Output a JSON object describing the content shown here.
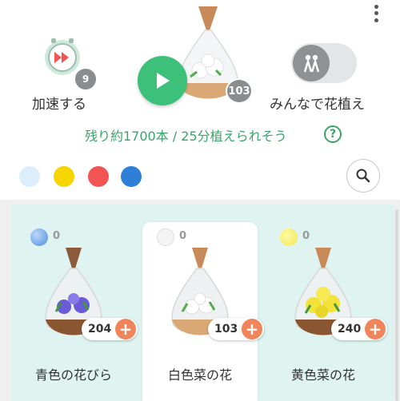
{
  "header": {
    "speed": {
      "label": "加速する",
      "count": "9",
      "icon": "fast-forward-clock-icon"
    },
    "current": {
      "count": "103",
      "icon": "play-icon"
    },
    "together": {
      "label": "みんなで花植え",
      "icon": "people-icon",
      "enabled": false
    },
    "remaining_text": "残り約1700本 / 25分植えられそう",
    "help_symbol": "?"
  },
  "filters": {
    "colors": [
      "#dceefc",
      "#f7d500",
      "#f25454",
      "#2e7fd8"
    ],
    "search_icon": "search-icon"
  },
  "items": [
    {
      "name": "青色の花びら",
      "owned": "0",
      "count": "204",
      "plus": "+",
      "accent": "#5aa0e8"
    },
    {
      "name": "白色菜の花",
      "owned": "0",
      "count": "103",
      "plus": "+",
      "accent": "#f4f4f4"
    },
    {
      "name": "黄色菜の花",
      "owned": "0",
      "count": "240",
      "plus": "+",
      "accent": "#f4e84a"
    }
  ],
  "colors": {
    "accent_green": "#3cc07a",
    "plus_orange": "#f0845a",
    "list_bg": "#dff3f0"
  }
}
